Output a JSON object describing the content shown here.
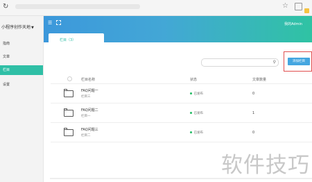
{
  "browser": {
    "reload_icon": "reload-icon"
  },
  "sidebar": {
    "brand": "小程序创作天地",
    "items": [
      {
        "label": "指南",
        "active": false
      },
      {
        "label": "文章",
        "active": false
      },
      {
        "label": "栏目",
        "active": true
      },
      {
        "label": "设置",
        "active": false
      }
    ]
  },
  "header": {
    "user": "我的Admin"
  },
  "tab": {
    "label": "栏目（3）"
  },
  "toolbar": {
    "search_placeholder": "",
    "add_label": "添加栏目"
  },
  "table": {
    "columns": [
      "栏目名称",
      "状态",
      "文章数量"
    ],
    "rows": [
      {
        "title": "FAQ问题一",
        "subtitle": "栏目三",
        "status": "已发布",
        "count": "0"
      },
      {
        "title": "FAQ问题二",
        "subtitle": "栏目一",
        "status": "已发布",
        "count": "1"
      },
      {
        "title": "FAQ问题三",
        "subtitle": "栏目二",
        "status": "已发布",
        "count": "0"
      }
    ]
  },
  "watermark": "软件技巧",
  "colors": {
    "accent": "#2fbfa6",
    "header_start": "#3c98db",
    "header_end": "#2fc3a3",
    "button": "#45a6e0",
    "highlight_border": "#e04f4f"
  }
}
